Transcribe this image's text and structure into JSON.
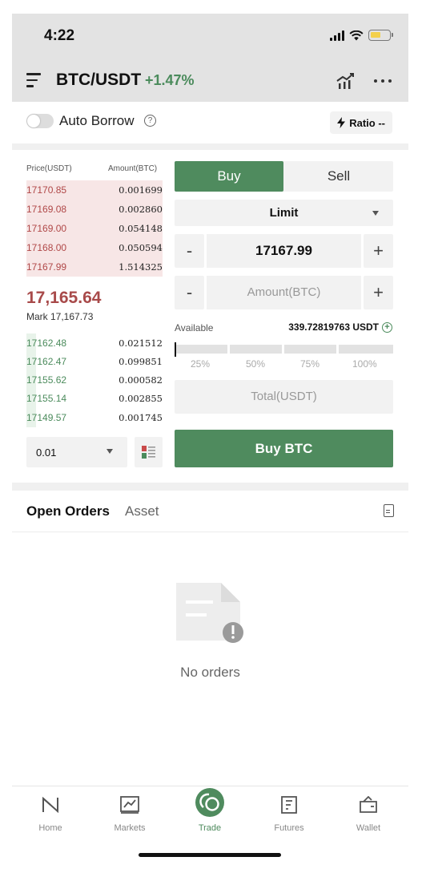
{
  "status_bar": {
    "time": "4:22"
  },
  "header": {
    "pair": "BTC/USDT",
    "change": "+1.47%"
  },
  "auto_borrow": {
    "label": "Auto Borrow",
    "ratio_label": "Ratio --"
  },
  "order_book": {
    "price_header": "Price(USDT)",
    "amount_header": "Amount(BTC)",
    "asks": [
      {
        "price": "17170.85",
        "amount": "0.001699"
      },
      {
        "price": "17169.08",
        "amount": "0.002860"
      },
      {
        "price": "17169.00",
        "amount": "0.054148"
      },
      {
        "price": "17168.00",
        "amount": "0.050594"
      },
      {
        "price": "17167.99",
        "amount": "1.514325"
      }
    ],
    "last_price": "17,165.64",
    "mark_price": "Mark 17,167.73",
    "bids": [
      {
        "price": "17162.48",
        "amount": "0.021512"
      },
      {
        "price": "17162.47",
        "amount": "0.099851"
      },
      {
        "price": "17155.62",
        "amount": "0.000582"
      },
      {
        "price": "17155.14",
        "amount": "0.002855"
      },
      {
        "price": "17149.57",
        "amount": "0.001745"
      }
    ],
    "depth_value": "0.01"
  },
  "order_form": {
    "buy_tab": "Buy",
    "sell_tab": "Sell",
    "order_type": "Limit",
    "minus": "-",
    "plus": "+",
    "price_value": "17167.99",
    "amount_placeholder": "Amount(BTC)",
    "available_label": "Available",
    "available_value": "339.72819763 USDT",
    "slider_percent": 0,
    "percent_marks": [
      "25%",
      "50%",
      "75%",
      "100%"
    ],
    "total_placeholder": "Total(USDT)",
    "submit_label": "Buy BTC"
  },
  "orders": {
    "tab_open": "Open Orders",
    "tab_asset": "Asset",
    "empty_text": "No orders"
  },
  "tab_bar": [
    {
      "label": "Home",
      "icon": "home-icon"
    },
    {
      "label": "Markets",
      "icon": "markets-icon"
    },
    {
      "label": "Trade",
      "icon": "trade-icon"
    },
    {
      "label": "Futures",
      "icon": "futures-icon"
    },
    {
      "label": "Wallet",
      "icon": "wallet-icon"
    }
  ],
  "colors": {
    "accent_green": "#4f8b5e",
    "ask_red": "#b04848"
  }
}
